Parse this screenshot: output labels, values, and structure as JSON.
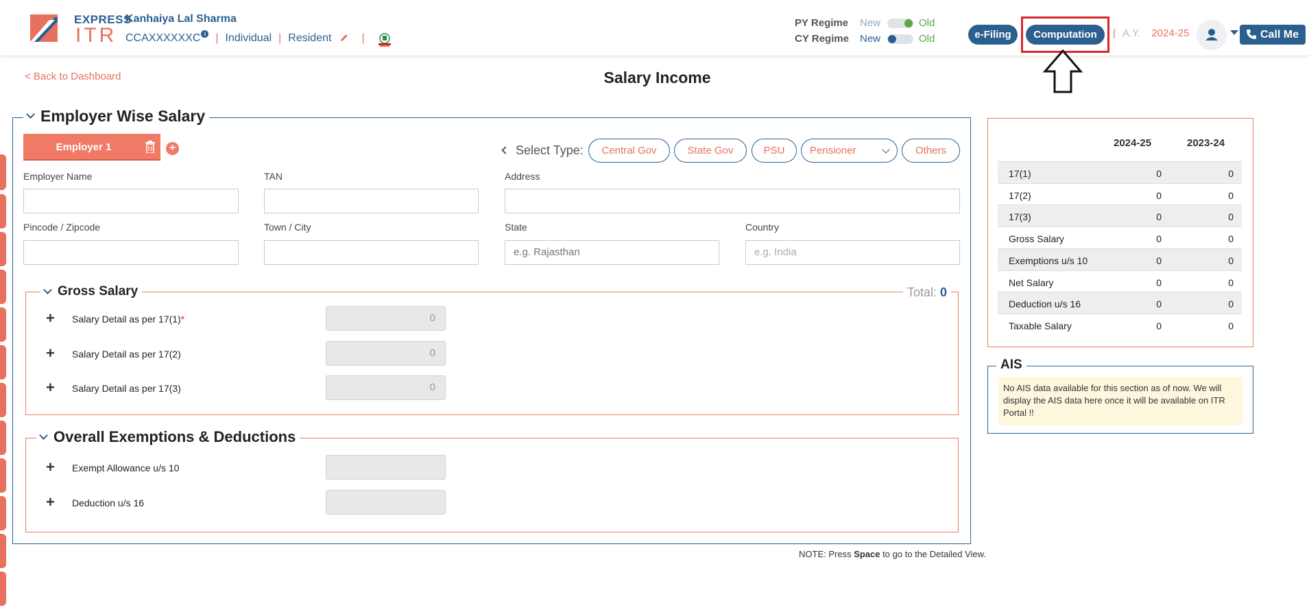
{
  "header": {
    "logo": {
      "express": "EXPRESS",
      "itr": "ITR"
    },
    "user_name": "Kanhaiya Lal Sharma",
    "pan": "CCAXXXXXXC",
    "info_glyph": "i",
    "status": "Individual",
    "residency": "Resident",
    "py_regime": {
      "label": "PY Regime",
      "new": "New",
      "old": "Old",
      "selected": "Old"
    },
    "cy_regime": {
      "label": "CY Regime",
      "new": "New",
      "old": "Old",
      "selected": "New"
    },
    "efiling_label": "e-Filing",
    "computation_label": "Computation",
    "ay_label": "A.Y.",
    "ay_value": "2024-25",
    "callme_label": "Call Me"
  },
  "nav": {
    "back_label": "< Back to Dashboard"
  },
  "page_title": "Salary Income",
  "employer_section": {
    "title": "Employer Wise Salary",
    "tab_label": "Employer 1",
    "add_glyph": "+",
    "select_type_label": "Select Type:",
    "types": [
      "Central Gov",
      "State Gov",
      "PSU",
      "Pensioner",
      "Others"
    ],
    "fields": {
      "employer_name": {
        "label": "Employer Name",
        "value": ""
      },
      "tan": {
        "label": "TAN",
        "value": ""
      },
      "address": {
        "label": "Address",
        "value": ""
      },
      "pincode": {
        "label": "Pincode / Zipcode",
        "value": ""
      },
      "town": {
        "label": "Town / City",
        "value": ""
      },
      "state": {
        "label": "State",
        "placeholder": "e.g. Rajasthan"
      },
      "country": {
        "label": "Country",
        "placeholder": "e.g. India"
      }
    }
  },
  "gross_salary": {
    "title": "Gross Salary",
    "total_label": "Total:",
    "total_value": "0",
    "rows": [
      {
        "label": "Salary Detail as per 17(1)",
        "required": "*",
        "value": "0"
      },
      {
        "label": "Salary Detail as per 17(2)",
        "value": "0"
      },
      {
        "label": "Salary Detail as per 17(3)",
        "value": "0"
      }
    ]
  },
  "exemptions": {
    "title": "Overall Exemptions & Deductions",
    "rows": [
      {
        "label": "Exempt Allowance u/s 10",
        "value": ""
      },
      {
        "label": "Deduction u/s 16",
        "value": ""
      }
    ]
  },
  "note": {
    "prefix": "NOTE: Press ",
    "key": "Space",
    "suffix": " to go to the Detailed View."
  },
  "summary": {
    "col1": "2024-25",
    "col2": "2023-24",
    "rows": [
      {
        "label": "17(1)",
        "v1": "0",
        "v2": "0"
      },
      {
        "label": "17(2)",
        "v1": "0",
        "v2": "0"
      },
      {
        "label": "17(3)",
        "v1": "0",
        "v2": "0"
      },
      {
        "label": "Gross Salary",
        "v1": "0",
        "v2": "0"
      },
      {
        "label": "Exemptions u/s 10",
        "v1": "0",
        "v2": "0"
      },
      {
        "label": "Net Salary",
        "v1": "0",
        "v2": "0"
      },
      {
        "label": "Deduction u/s 16",
        "v1": "0",
        "v2": "0"
      },
      {
        "label": "Taxable Salary",
        "v1": "0",
        "v2": "0"
      }
    ]
  },
  "ais": {
    "title": "AIS",
    "message": "No AIS data available for this section as of now. We will display the AIS data here once it will be available on ITR Portal !!"
  },
  "colors": {
    "brand_blue": "#2a5f8f",
    "brand_coral": "#e8705e",
    "highlight_red": "#d9262c",
    "regime_green": "#5aa84a"
  },
  "icons": [
    "edit-pencil-icon",
    "emblem-icon",
    "info-icon",
    "trash-icon",
    "plus-icon",
    "user-icon",
    "phone-icon",
    "chevron-down-icon",
    "chevron-left-icon",
    "arrow-up-annotation"
  ]
}
